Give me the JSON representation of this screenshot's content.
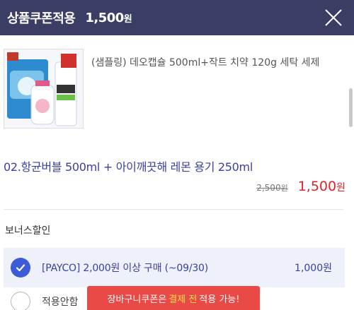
{
  "header": {
    "title": "상품쿠폰적용",
    "price_value": "1,500",
    "price_unit": "원",
    "close_icon": "close-icon"
  },
  "product": {
    "name": "(샘플링) 데오캡슐 500ml+작트 치약 120g 세탁 세제",
    "thumb_icon": "product-thumbnail"
  },
  "option": {
    "name": "02.항균버블 500ml + 아이깨끗해 레몬 용기 250ml",
    "orig_value": "2,500",
    "orig_unit": "원",
    "sale_value": "1,500",
    "sale_unit": "원"
  },
  "bonus": {
    "title": "보너스할인",
    "coupon_label": "[PAYCO] 2,000원 이상 구매 (~09/30)",
    "coupon_amount": "1,000원",
    "noapply_label": "적용안함"
  },
  "toast": {
    "prefix": "장바구니쿠폰은",
    "highlight": "결제 전",
    "suffix": "적용 가능!"
  },
  "colors": {
    "header_bg": "#3b3e64",
    "accent": "#3b5bd9",
    "sale": "#e0222a",
    "toast_bg": "#ea4a45"
  }
}
